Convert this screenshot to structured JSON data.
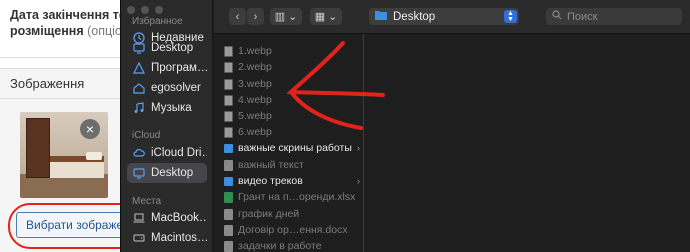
{
  "web": {
    "label_main": "Дата закінчення терм",
    "label_sub": "розміщення",
    "label_sub_hint": " (опціона",
    "section_title": "Зображення",
    "remove_glyph": "×",
    "upload_button": "Вибрати зображенн"
  },
  "dialog": {
    "sidebar": {
      "favorites_heading": "Избранное",
      "favorites": [
        {
          "label": "Недавние",
          "icon": "clock-icon"
        },
        {
          "label": "Desktop",
          "icon": "desktop-icon"
        },
        {
          "label": "Програм…",
          "icon": "apps-icon"
        },
        {
          "label": "egosolver",
          "icon": "home-icon"
        },
        {
          "label": "Музыка",
          "icon": "music-icon"
        }
      ],
      "icloud_heading": "iCloud",
      "icloud": [
        {
          "label": "iCloud Dri…",
          "icon": "cloud-icon"
        },
        {
          "label": "Desktop",
          "icon": "desktop-icon",
          "selected": true
        }
      ],
      "places_heading": "Места",
      "places": [
        {
          "label": "MacBook…",
          "icon": "laptop-icon"
        },
        {
          "label": "Macintos…",
          "icon": "drive-icon"
        }
      ]
    },
    "toolbar": {
      "back": "‹",
      "forward": "›",
      "view_columns": "▥",
      "view_grid": "▦",
      "chevron": "⌄",
      "location": "Desktop",
      "search_placeholder": "Поиск"
    },
    "files": [
      {
        "name": "1.webp",
        "kind": "img",
        "style": "dim"
      },
      {
        "name": "2.webp",
        "kind": "img",
        "style": "dim"
      },
      {
        "name": "3.webp",
        "kind": "img",
        "style": "dim"
      },
      {
        "name": "4.webp",
        "kind": "img",
        "style": "dim"
      },
      {
        "name": "5.webp",
        "kind": "img",
        "style": "dim"
      },
      {
        "name": "6.webp",
        "kind": "img",
        "style": "dim"
      },
      {
        "name": "важные скрины работы",
        "kind": "folder",
        "style": "bright",
        "arrow": "›"
      },
      {
        "name": "важный текст",
        "kind": "doc",
        "style": "dim"
      },
      {
        "name": "видео треков",
        "kind": "folder",
        "style": "bright",
        "arrow": "›"
      },
      {
        "name": "Грант на п…оренди.xlsx",
        "kind": "xls",
        "style": "dim"
      },
      {
        "name": "график дней",
        "kind": "doc",
        "style": "dim"
      },
      {
        "name": "Договір ор…ення.docx",
        "kind": "word",
        "style": "dim"
      },
      {
        "name": "задачки в работе",
        "kind": "doc",
        "style": "dim"
      }
    ]
  },
  "colors": {
    "annotation_red": "#e0231b",
    "accent_blue": "#2f6fd9",
    "folder_blue": "#3a8fe0"
  }
}
